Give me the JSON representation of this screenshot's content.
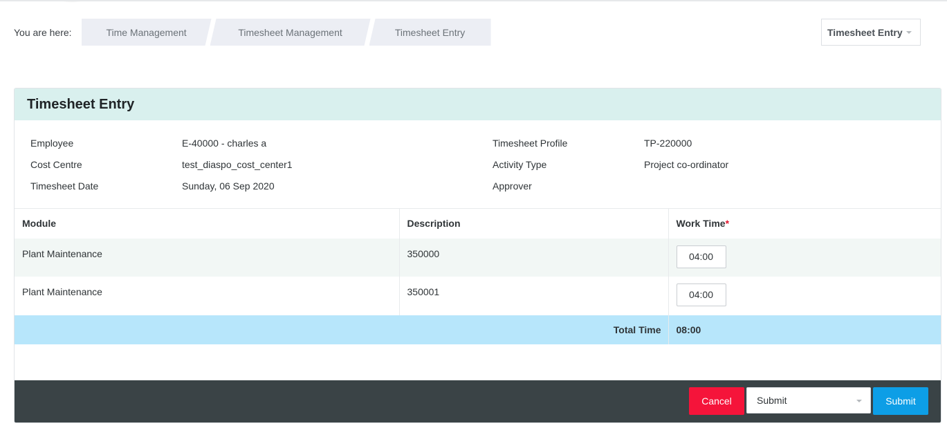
{
  "breadcrumb": {
    "label": "You are here:",
    "items": [
      "Time Management",
      "Timesheet Management",
      "Timesheet Entry"
    ]
  },
  "page_select": {
    "value": "Timesheet Entry"
  },
  "card": {
    "title": "Timesheet Entry",
    "info_left": {
      "labels": [
        "Employee",
        "Cost Centre",
        "Timesheet Date"
      ],
      "values": [
        "E-40000 - charles a",
        "test_diaspo_cost_center1",
        "Sunday, 06 Sep 2020"
      ]
    },
    "info_right": {
      "labels": [
        "Timesheet Profile",
        "Activity Type",
        "Approver"
      ],
      "values": [
        "TP-220000",
        "Project co-ordinator",
        ""
      ]
    },
    "table": {
      "headers": {
        "module": "Module",
        "description": "Description",
        "work_time": "Work Time",
        "required_mark": "*"
      },
      "rows": [
        {
          "module": "Plant Maintenance",
          "description": "350000",
          "work_time": "04:00"
        },
        {
          "module": "Plant Maintenance",
          "description": "350001",
          "work_time": "04:00"
        }
      ],
      "total_label": "Total Time",
      "total_value": "08:00"
    }
  },
  "footer": {
    "cancel_label": "Cancel",
    "action_select_value": "Submit",
    "submit_label": "Submit"
  },
  "colors": {
    "header_bg": "#d9f0ee",
    "total_bg": "#b7e6fb",
    "cancel": "#f5143a",
    "submit": "#0d9ee6",
    "footer_bg": "#3a4346"
  }
}
